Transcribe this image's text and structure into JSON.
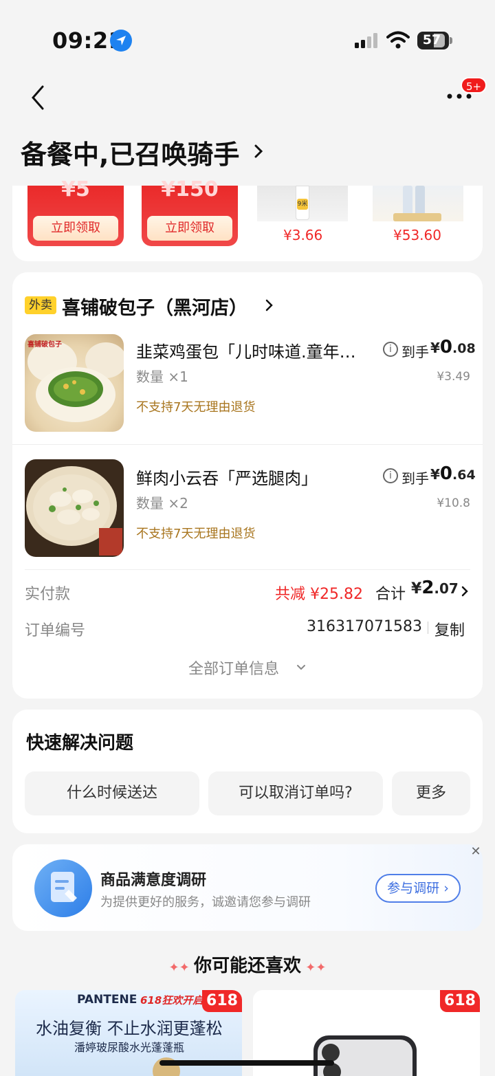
{
  "status_bar": {
    "time": "09:21",
    "battery": "57"
  },
  "nav": {
    "badge": "5+",
    "title": "备餐中,已召唤骑手"
  },
  "coupons": [
    {
      "amount": "¥5",
      "button": "立即领取"
    },
    {
      "amount": "¥150",
      "button": "立即领取"
    }
  ],
  "promo_products": [
    {
      "label": "9米",
      "price": "¥3.66"
    },
    {
      "price": "¥53.60"
    }
  ],
  "order": {
    "tag": "外卖",
    "shop": "喜铺破包子（黑河店）",
    "items": [
      {
        "name": "韭菜鸡蛋包「儿时味道.童年…",
        "qty": "数量 ×1",
        "return_note": "不支持7天无理由退货",
        "pre": "到手",
        "currency": "¥",
        "price_int": "0",
        "price_dec": ".08",
        "orig": "¥3.49",
        "img_brand": "喜铺破包子"
      },
      {
        "name": "鲜肉小云吞「严选腿肉」",
        "qty": "数量 ×2",
        "return_note": "不支持7天无理由退货",
        "pre": "到手",
        "currency": "¥",
        "price_int": "0",
        "price_dec": ".64",
        "orig": "¥10.8"
      }
    ],
    "paid_label": "实付款",
    "discount": "共减 ¥25.82",
    "total_label": "合计",
    "total_currency": "¥",
    "total_int": "2",
    "total_dec": ".07",
    "order_no_label": "订单编号",
    "order_no": "316317071583",
    "copy": "复制",
    "all_info": "全部订单信息"
  },
  "quick": {
    "title": "快速解决问题",
    "buttons": [
      "什么时候送达",
      "可以取消订单吗?",
      "更多"
    ]
  },
  "survey": {
    "title": "商品满意度调研",
    "subtitle": "为提供更好的服务，诚邀请您参与调研",
    "button": "参与调研 ›"
  },
  "recommend": {
    "title": "你可能还喜欢",
    "cards": [
      {
        "tag": "618",
        "brand": "PANTENE",
        "event": "618狂欢开启",
        "headline": "水油复衡 不止水润更蓬松",
        "sub": "潘婷玻尿酸水光蓬蓬瓶"
      },
      {
        "tag": "618"
      }
    ]
  },
  "colors": {
    "accent_red": "#f02828",
    "link_blue": "#3e6fe0",
    "tag_yellow": "#ffd12b"
  }
}
